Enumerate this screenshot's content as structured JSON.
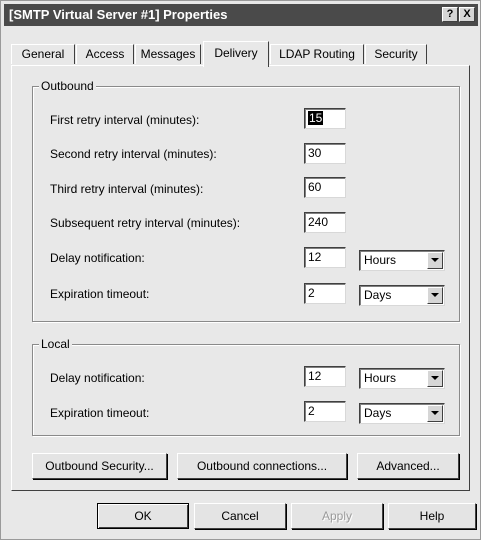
{
  "window": {
    "title": "[SMTP Virtual Server #1] Properties",
    "help_glyph": "?",
    "close_glyph": "X"
  },
  "tabs": [
    {
      "label": "General"
    },
    {
      "label": "Access"
    },
    {
      "label": "Messages"
    },
    {
      "label": "Delivery"
    },
    {
      "label": "LDAP Routing"
    },
    {
      "label": "Security"
    }
  ],
  "active_tab": "Delivery",
  "outbound": {
    "legend": "Outbound",
    "first_retry": {
      "label": "First retry interval (minutes):",
      "value": "15"
    },
    "second_retry": {
      "label": "Second retry interval (minutes):",
      "value": "30"
    },
    "third_retry": {
      "label": "Third retry interval (minutes):",
      "value": "60"
    },
    "subsequent_retry": {
      "label": "Subsequent retry interval (minutes):",
      "value": "240"
    },
    "delay_notification": {
      "label": "Delay notification:",
      "value": "12",
      "unit": "Hours"
    },
    "expiration_timeout": {
      "label": "Expiration timeout:",
      "value": "2",
      "unit": "Days"
    }
  },
  "local": {
    "legend": "Local",
    "delay_notification": {
      "label": "Delay notification:",
      "value": "12",
      "unit": "Hours"
    },
    "expiration_timeout": {
      "label": "Expiration timeout:",
      "value": "2",
      "unit": "Days"
    }
  },
  "panel_buttons": {
    "outbound_security": "Outbound Security...",
    "outbound_connections": "Outbound connections...",
    "advanced": "Advanced..."
  },
  "dialog_buttons": {
    "ok": "OK",
    "cancel": "Cancel",
    "apply": "Apply",
    "help": "Help"
  },
  "colors": {
    "titlebar": "#4a4a4a",
    "face": "#e8e8e8",
    "selection": "#000000"
  }
}
